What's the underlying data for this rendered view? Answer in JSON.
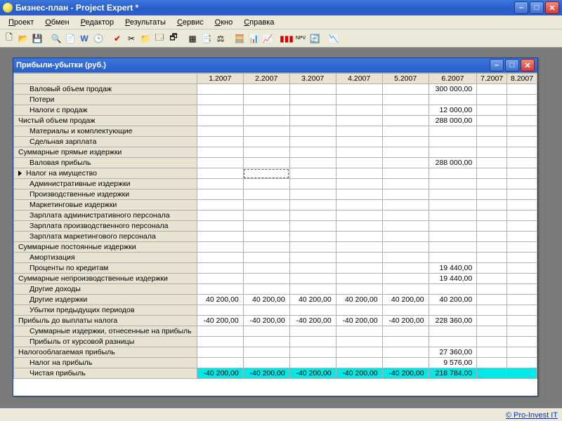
{
  "app": {
    "title": "Бизнес-план - Project Expert *"
  },
  "menus": [
    "Проект",
    "Обмен",
    "Редактор",
    "Результаты",
    "Сервис",
    "Окно",
    "Справка"
  ],
  "child_window": {
    "title": "Прибыли-убытки (руб.)"
  },
  "columns": [
    "1.2007",
    "2.2007",
    "3.2007",
    "4.2007",
    "5.2007",
    "6.2007",
    "7.2007",
    "8.2007"
  ],
  "rows": [
    {
      "label": "Валовый объем продаж",
      "indent": 1,
      "values": [
        "",
        "",
        "",
        "",
        "",
        "300 000,00",
        "",
        ""
      ]
    },
    {
      "label": "Потери",
      "indent": 1,
      "values": [
        "",
        "",
        "",
        "",
        "",
        "",
        "",
        ""
      ]
    },
    {
      "label": "Налоги с продаж",
      "indent": 1,
      "values": [
        "",
        "",
        "",
        "",
        "",
        "12 000,00",
        "",
        ""
      ]
    },
    {
      "label": "Чистый объем продаж",
      "indent": 0,
      "values": [
        "",
        "",
        "",
        "",
        "",
        "288 000,00",
        "",
        ""
      ]
    },
    {
      "label": "Материалы и комплектующие",
      "indent": 1,
      "values": [
        "",
        "",
        "",
        "",
        "",
        "",
        "",
        ""
      ]
    },
    {
      "label": "Сдельная зарплата",
      "indent": 1,
      "values": [
        "",
        "",
        "",
        "",
        "",
        "",
        "",
        ""
      ]
    },
    {
      "label": "Суммарные прямые издержки",
      "indent": 0,
      "values": [
        "",
        "",
        "",
        "",
        "",
        "",
        "",
        ""
      ]
    },
    {
      "label": "Валовая прибыль",
      "indent": 1,
      "values": [
        "",
        "",
        "",
        "",
        "",
        "288 000,00",
        "",
        ""
      ]
    },
    {
      "label": "Налог на имущество",
      "indent": 1,
      "arrow": true,
      "selected_col": 1,
      "values": [
        "",
        "",
        "",
        "",
        "",
        "",
        "",
        ""
      ]
    },
    {
      "label": "Административные издержки",
      "indent": 1,
      "values": [
        "",
        "",
        "",
        "",
        "",
        "",
        "",
        ""
      ]
    },
    {
      "label": "Производственные издержки",
      "indent": 1,
      "values": [
        "",
        "",
        "",
        "",
        "",
        "",
        "",
        ""
      ]
    },
    {
      "label": "Маркетинговые издержки",
      "indent": 1,
      "values": [
        "",
        "",
        "",
        "",
        "",
        "",
        "",
        ""
      ]
    },
    {
      "label": "Зарплата административного персонала",
      "indent": 1,
      "values": [
        "",
        "",
        "",
        "",
        "",
        "",
        "",
        ""
      ]
    },
    {
      "label": "Зарплата производственного персонала",
      "indent": 1,
      "values": [
        "",
        "",
        "",
        "",
        "",
        "",
        "",
        ""
      ]
    },
    {
      "label": "Зарплата маркетингового персонала",
      "indent": 1,
      "values": [
        "",
        "",
        "",
        "",
        "",
        "",
        "",
        ""
      ]
    },
    {
      "label": "Суммарные постоянные издержки",
      "indent": 0,
      "values": [
        "",
        "",
        "",
        "",
        "",
        "",
        "",
        ""
      ]
    },
    {
      "label": "Амортизация",
      "indent": 1,
      "values": [
        "",
        "",
        "",
        "",
        "",
        "",
        "",
        ""
      ]
    },
    {
      "label": "Проценты по кредитам",
      "indent": 1,
      "values": [
        "",
        "",
        "",
        "",
        "",
        "19 440,00",
        "",
        ""
      ]
    },
    {
      "label": "Суммарные непроизводственные издержки",
      "indent": 0,
      "values": [
        "",
        "",
        "",
        "",
        "",
        "19 440,00",
        "",
        ""
      ]
    },
    {
      "label": "Другие доходы",
      "indent": 1,
      "values": [
        "",
        "",
        "",
        "",
        "",
        "",
        "",
        ""
      ]
    },
    {
      "label": "Другие издержки",
      "indent": 1,
      "values": [
        "40 200,00",
        "40 200,00",
        "40 200,00",
        "40 200,00",
        "40 200,00",
        "40 200,00",
        "",
        ""
      ]
    },
    {
      "label": "Убытки предыдущих периодов",
      "indent": 1,
      "values": [
        "",
        "",
        "",
        "",
        "",
        "",
        "",
        ""
      ]
    },
    {
      "label": "Прибыль до выплаты налога",
      "indent": 0,
      "values": [
        "-40 200,00",
        "-40 200,00",
        "-40 200,00",
        "-40 200,00",
        "-40 200,00",
        "228 360,00",
        "",
        ""
      ]
    },
    {
      "label": "Суммарные издержки, отнесенные на прибыль",
      "indent": 1,
      "values": [
        "",
        "",
        "",
        "",
        "",
        "",
        "",
        ""
      ]
    },
    {
      "label": "Прибыль от курсовой разницы",
      "indent": 1,
      "values": [
        "",
        "",
        "",
        "",
        "",
        "",
        "",
        ""
      ]
    },
    {
      "label": "Налогооблагаемая прибыль",
      "indent": 0,
      "values": [
        "",
        "",
        "",
        "",
        "",
        "27 360,00",
        "",
        ""
      ]
    },
    {
      "label": "Налог на прибыль",
      "indent": 1,
      "values": [
        "",
        "",
        "",
        "",
        "",
        "9 576,00",
        "",
        ""
      ]
    },
    {
      "label": "Чистая прибыль",
      "indent": 1,
      "highlight": true,
      "values": [
        "-40 200,00",
        "-40 200,00",
        "-40 200,00",
        "-40 200,00",
        "-40 200,00",
        "218 784,00",
        "",
        ""
      ]
    }
  ],
  "status": {
    "link": "© Pro-Invest IT"
  }
}
